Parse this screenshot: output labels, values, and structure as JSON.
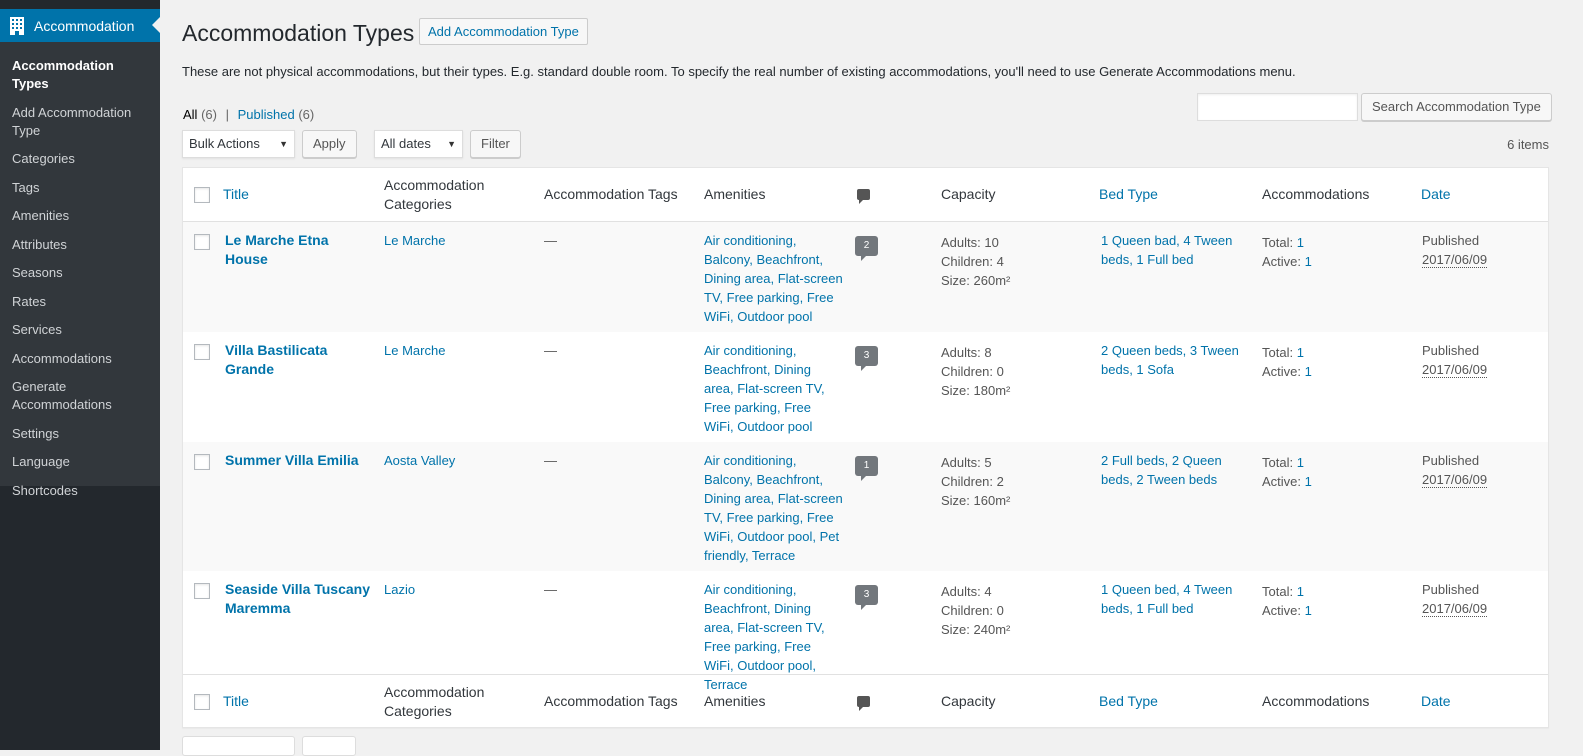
{
  "sidebar": {
    "menu_title": "Accommodation",
    "items": [
      {
        "label": "Accommodation Types",
        "current": true
      },
      {
        "label": "Add Accommodation Type"
      },
      {
        "label": "Categories"
      },
      {
        "label": "Tags"
      },
      {
        "label": "Amenities"
      },
      {
        "label": "Attributes"
      },
      {
        "label": "Seasons"
      },
      {
        "label": "Rates"
      },
      {
        "label": "Services"
      },
      {
        "label": "Accommodations"
      },
      {
        "label": "Generate Accommodations"
      },
      {
        "label": "Settings"
      },
      {
        "label": "Language"
      },
      {
        "label": "Shortcodes"
      }
    ]
  },
  "header": {
    "title": "Accommodation Types",
    "add_button": "Add Accommodation Type",
    "description": "These are not physical accommodations, but their types. E.g. standard double room. To specify the real number of existing accommodations, you'll need to use Generate Accommodations menu."
  },
  "views": {
    "all_label": "All",
    "all_count": "(6)",
    "separator": "|",
    "published_label": "Published",
    "published_count": "(6)"
  },
  "search": {
    "button_label": "Search Accommodation Type",
    "value": ""
  },
  "filters": {
    "bulk_actions": "Bulk Actions",
    "apply": "Apply",
    "dates": "All dates",
    "filter": "Filter",
    "items_count": "6 items"
  },
  "columns": {
    "title": "Title",
    "categories": "Accommodation Categories",
    "tags": "Accommodation Tags",
    "amenities": "Amenities",
    "capacity": "Capacity",
    "bed_type": "Bed Type",
    "accommodations": "Accommodations",
    "date": "Date"
  },
  "rows": [
    {
      "title": "Le Marche Etna House",
      "category": "Le Marche",
      "tags": "—",
      "amenities": "Air conditioning, Balcony, Beachfront, Dining area, Flat-screen TV, Free parking, Free WiFi, Outdoor pool",
      "comments": "2",
      "adults": "Adults: 10",
      "children": "Children: 4",
      "size": "Size: 260m²",
      "bed_type": "1 Queen bad, 4 Tween beds, 1 Full bed",
      "total_label": "Total:",
      "total": "1",
      "active_label": "Active:",
      "active": "1",
      "status": "Published",
      "date": "2017/06/09"
    },
    {
      "title": "Villa Bastilicata Grande",
      "category": "Le Marche",
      "tags": "—",
      "amenities": "Air conditioning, Beachfront, Dining area, Flat-screen TV, Free parking, Free WiFi, Outdoor pool",
      "comments": "3",
      "adults": "Adults: 8",
      "children": "Children: 0",
      "size": "Size: 180m²",
      "bed_type": "2 Queen beds, 3 Tween beds, 1 Sofa",
      "total_label": "Total:",
      "total": "1",
      "active_label": "Active:",
      "active": "1",
      "status": "Published",
      "date": "2017/06/09"
    },
    {
      "title": "Summer Villa Emilia",
      "category": "Aosta Valley",
      "tags": "—",
      "amenities": "Air conditioning, Balcony, Beachfront, Dining area, Flat-screen TV, Free parking, Free WiFi, Outdoor pool, Pet friendly, Terrace",
      "comments": "1",
      "adults": "Adults: 5",
      "children": "Children: 2",
      "size": "Size: 160m²",
      "bed_type": "2 Full beds, 2 Queen beds, 2 Tween beds",
      "total_label": "Total:",
      "total": "1",
      "active_label": "Active:",
      "active": "1",
      "status": "Published",
      "date": "2017/06/09"
    },
    {
      "title": "Seaside Villa Tuscany Maremma",
      "category": "Lazio",
      "tags": "—",
      "amenities": "Air conditioning, Beachfront, Dining area, Flat-screen TV, Free parking, Free WiFi, Outdoor pool, Terrace",
      "comments": "3",
      "adults": "Adults: 4",
      "children": "Children: 0",
      "size": "Size: 240m²",
      "bed_type": "1 Queen bed, 4 Tween beds, 1 Full bed",
      "total_label": "Total:",
      "total": "1",
      "active_label": "Active:",
      "active": "1",
      "status": "Published",
      "date": "2017/06/09"
    }
  ],
  "colors": {
    "sidebar_bg": "#23282d",
    "submenu_bg": "#32373c",
    "accent": "#0073aa",
    "page_bg": "#f1f1f1"
  },
  "icons": {
    "menu": "building-icon",
    "comments_column": "comment-bubble-icon",
    "dropdown": "chevron-down-icon"
  }
}
